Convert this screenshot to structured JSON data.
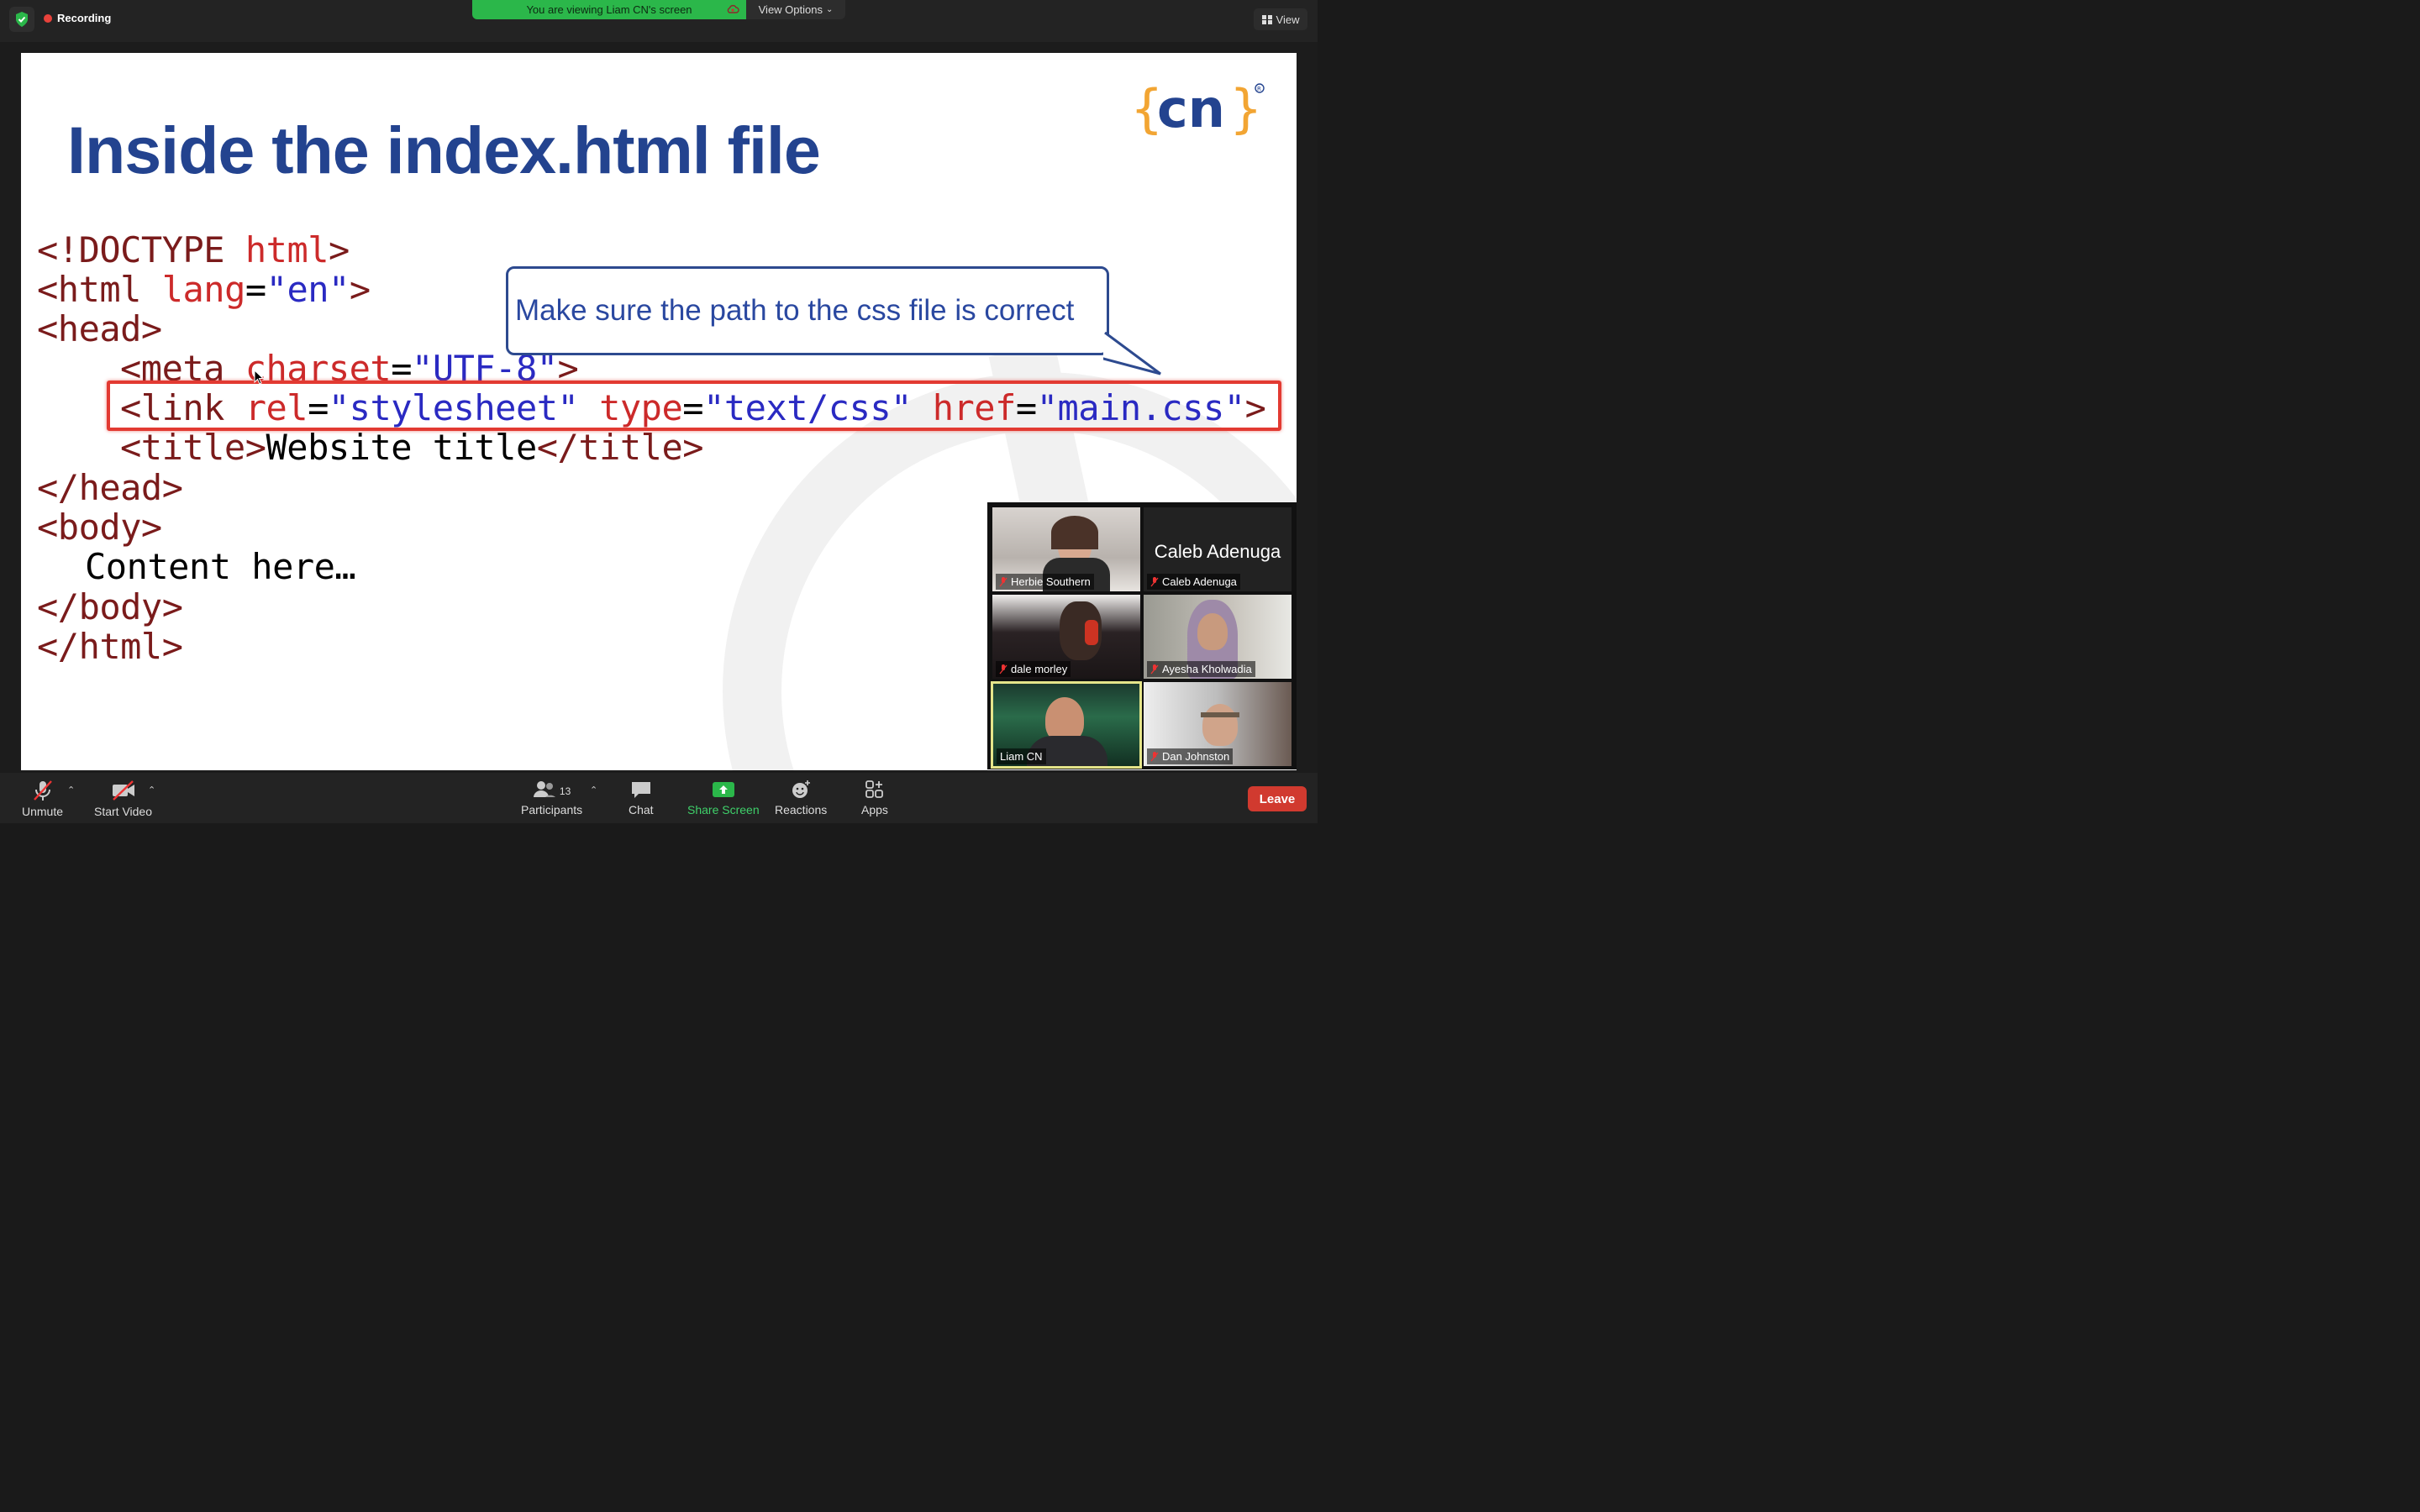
{
  "topbar": {
    "recording_label": "Recording",
    "viewing_banner": "You are viewing Liam CN's screen",
    "view_options_label": "View Options",
    "view_label": "View"
  },
  "slide": {
    "title": "Inside the index.html file",
    "logo_text": "{cn}",
    "callout": "Make sure the path to the css file is correct",
    "code": {
      "doctype_open": "<!DOCTYPE ",
      "doctype_html": "html",
      "doctype_close": ">",
      "html_open": "<html ",
      "html_attr": "lang",
      "eq": "=",
      "html_val": "\"en\"",
      "gt": ">",
      "head_open": "<head>",
      "meta_open": "<meta ",
      "meta_attr": "charset",
      "meta_val": "\"UTF-8\"",
      "link_open": "<link ",
      "link_rel": "rel",
      "link_rel_val": "\"stylesheet\"",
      "link_type": "type",
      "link_type_val": "\"text/css\"",
      "link_href": "href",
      "link_href_val": "\"main.css\"",
      "title_open": "<title>",
      "title_text": "Website title",
      "title_close": "</title>",
      "head_close": "</head>",
      "body_open": "<body>",
      "content": "Content here…",
      "body_close": "</body>",
      "html_close": "</html>"
    }
  },
  "gallery": {
    "participants": [
      {
        "name": "Herbie Southern",
        "muted": true
      },
      {
        "name": "Caleb Adenuga",
        "muted": true,
        "big_name": "Caleb Adenuga"
      },
      {
        "name": "dale morley",
        "muted": true
      },
      {
        "name": "Ayesha Kholwadia",
        "muted": true
      },
      {
        "name": "Liam CN",
        "muted": false
      },
      {
        "name": "Dan Johnston",
        "muted": true
      }
    ]
  },
  "toolbar": {
    "unmute_label": "Unmute",
    "start_video_label": "Start Video",
    "participants_label": "Participants",
    "participants_count": "13",
    "chat_label": "Chat",
    "share_screen_label": "Share Screen",
    "reactions_label": "Reactions",
    "apps_label": "Apps",
    "leave_label": "Leave"
  },
  "colors": {
    "accent_green": "#2bb74a",
    "leave_red": "#d13a2f",
    "highlight_red": "#e23a32",
    "title_blue": "#23438f",
    "active_speaker_border": "#e5e58a"
  }
}
